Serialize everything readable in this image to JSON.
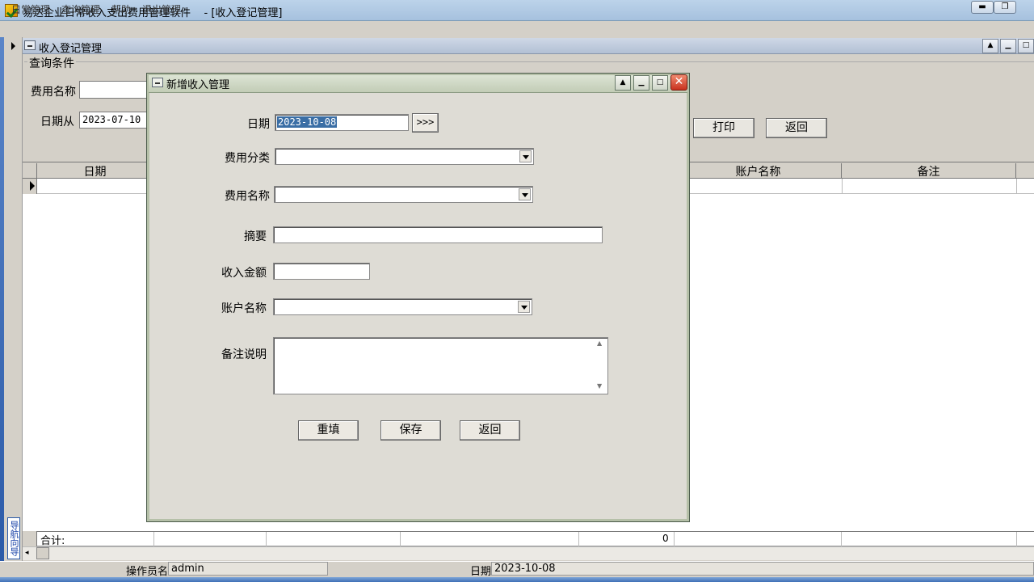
{
  "app": {
    "title": "易达企业日常收入支出费用管理软件    - [收入登记管理]",
    "min_glyph": "▬",
    "max_glyph": "❐"
  },
  "menu": [
    "日常管理",
    "查询管理",
    "帮助",
    "退出管理"
  ],
  "side": {
    "vertical_label": "导航向导"
  },
  "child": {
    "title": "收入登记管理",
    "query_group_title": "查询条件",
    "fee_name_label": "费用名称",
    "fee_name_value": "",
    "date_from_label": "日期从",
    "date_from_value": "2023-07-10",
    "print_label": "打印",
    "back_label": "返回",
    "up_glyph": "▲",
    "min_glyph": "▁",
    "max_glyph": "□"
  },
  "grid": {
    "headers": {
      "date": "日期",
      "account": "账户名称",
      "note": "备注"
    },
    "sum_label": "合计:",
    "sum_value": "0"
  },
  "status": {
    "operator_label": "操作员名",
    "operator_value": "admin",
    "date_label": "日期",
    "date_value": "2023-10-08"
  },
  "dialog": {
    "title": "新增收入管理",
    "close_glyph": "✕",
    "up_glyph": "▲",
    "min_glyph": "▁",
    "max_glyph": "□",
    "labels": {
      "date": "日期",
      "category": "费用分类",
      "fee_name": "费用名称",
      "summary": "摘要",
      "amount": "收入金额",
      "account": "账户名称",
      "note": "备注说明"
    },
    "values": {
      "date": "2023-10-08",
      "category": "",
      "fee_name": "",
      "summary": "",
      "amount": "",
      "account": "",
      "note": ""
    },
    "date_picker_label": ">>>",
    "buttons": {
      "reset": "重填",
      "save": "保存",
      "return": "返回"
    }
  },
  "icons": {
    "app": "app-logo-icon",
    "dropdown": "chevron-down-icon",
    "row_pointer": "row-pointer-icon"
  }
}
